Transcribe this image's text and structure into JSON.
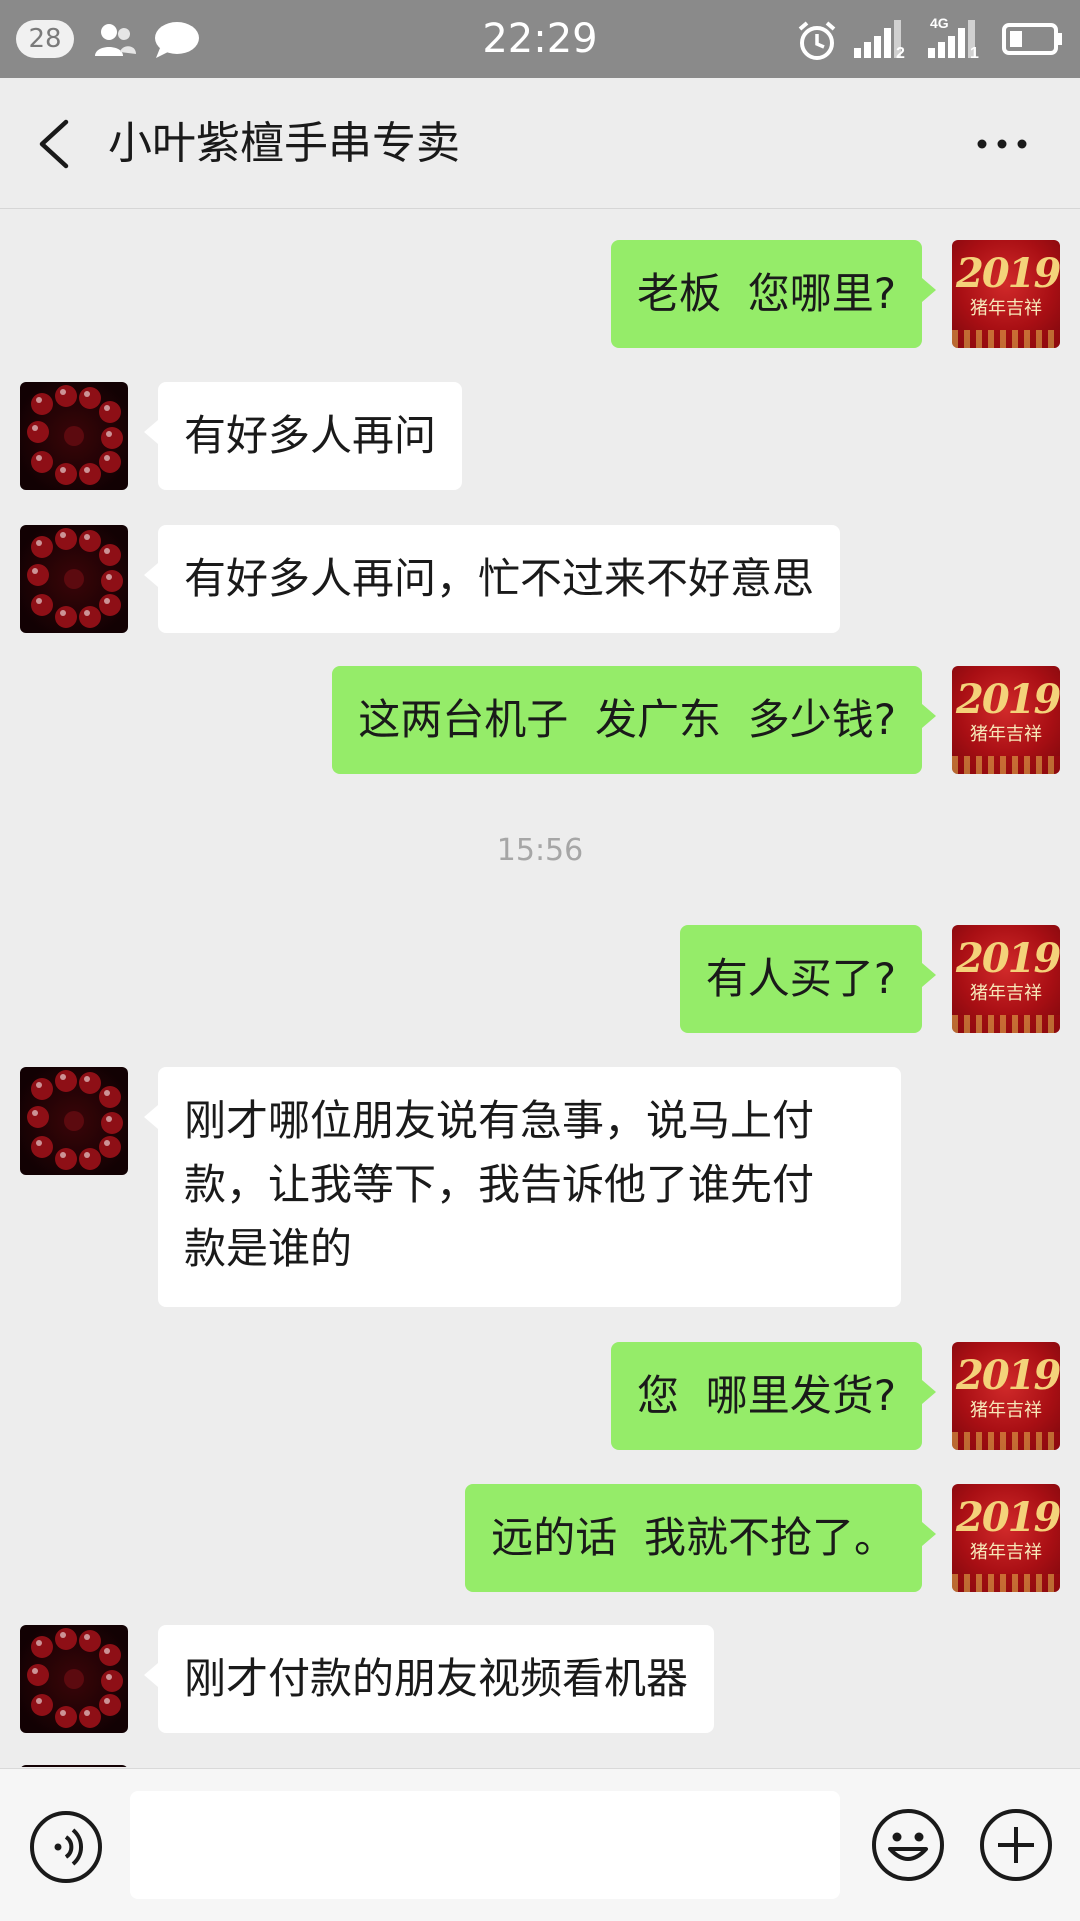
{
  "status_bar": {
    "notification_count": "28",
    "time": "22:29",
    "sim1_label": "2",
    "sim2_label": "1",
    "network_label": "4G"
  },
  "header": {
    "title": "小叶紫檀手串专卖"
  },
  "avatars": {
    "me_year": "2019",
    "me_caption": "猪年吉祥"
  },
  "messages": [
    {
      "side": "me",
      "text": "老板  您哪里?"
    },
    {
      "side": "them",
      "text": "有好多人再问"
    },
    {
      "side": "them",
      "text": "有好多人再问，忙不过来不好意思"
    },
    {
      "side": "me",
      "text": "这两台机子  发广东  多少钱?"
    },
    {
      "side": "time",
      "text": "15:56"
    },
    {
      "side": "me",
      "text": "有人买了?"
    },
    {
      "side": "them",
      "text": "刚才哪位朋友说有急事，说马上付\n款，让我等下，我告诉他了谁先付\n款是谁的"
    },
    {
      "side": "me",
      "text": "您  哪里发货?"
    },
    {
      "side": "me",
      "text": "远的话  我就不抢了。"
    },
    {
      "side": "them",
      "text": "刚才付款的朋友视频看机器"
    }
  ],
  "input": {
    "value": "",
    "placeholder": ""
  },
  "colors": {
    "me_bubble": "#95ec69",
    "them_bubble": "#ffffff",
    "background": "#ededed",
    "status_bar": "#8a8a8a"
  },
  "icons": [
    "contacts-icon",
    "chat-icon",
    "alarm-icon",
    "signal-icon",
    "battery-icon",
    "back-icon",
    "more-icon",
    "voice-icon",
    "emoji-icon",
    "plus-icon"
  ]
}
